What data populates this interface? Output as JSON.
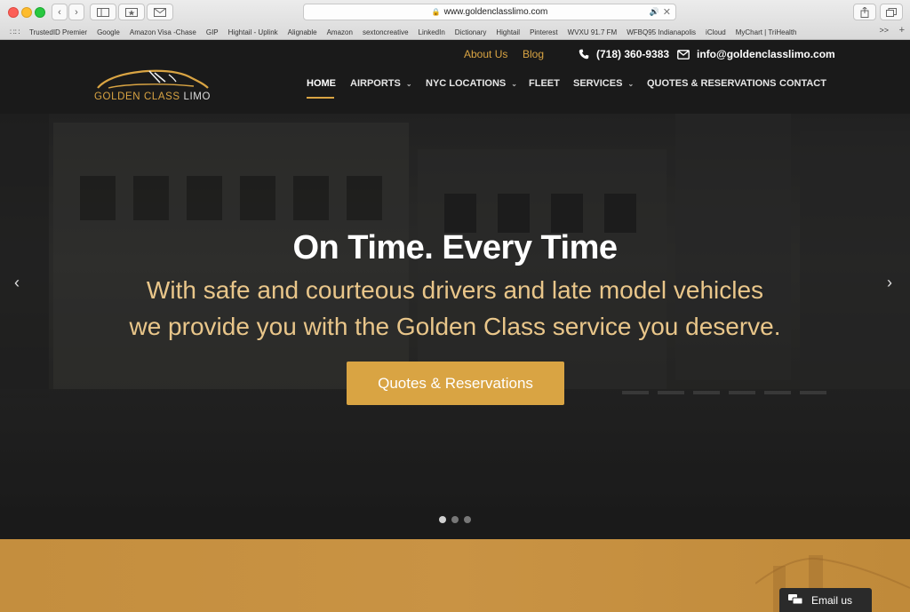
{
  "browser": {
    "url": "www.goldenclasslimo.com",
    "bookmarks": [
      "TrustedID Premier",
      "Google",
      "Amazon Visa -Chase",
      "GIP",
      "Hightail - Uplink",
      "Alignable",
      "Amazon",
      "sextoncreative",
      "LinkedIn",
      "Dictionary",
      "Hightail",
      "Pinterest",
      "WVXU 91.7 FM",
      "WFBQ95 Indianapolis",
      "iCloud",
      "MyChart | TriHealth"
    ],
    "more_label": ">>",
    "new_tab_label": "+"
  },
  "topbar": {
    "about_label": "About Us",
    "blog_label": "Blog",
    "phone": "(718) 360-9383",
    "email": "info@goldenclasslimo.com"
  },
  "logo": {
    "gold_text": "GOLDEN CLASS",
    "white_text": "LIMO"
  },
  "nav": {
    "home": "HOME",
    "airports": "AIRPORTS",
    "nyc_locations": "NYC LOCATIONS",
    "fleet": "FLEET",
    "services": "SERVICES",
    "quotes": "QUOTES & RESERVATIONS",
    "contact": "CONTACT"
  },
  "hero": {
    "title": "On Time. Every Time",
    "subtitle_line1": "With safe and courteous drivers and late model vehicles",
    "subtitle_line2": "we provide you with the Golden Class service you deserve.",
    "cta_label": "Quotes & Reservations",
    "prev_label": "‹",
    "next_label": "›"
  },
  "widget": {
    "email_label": "Email us"
  },
  "colors": {
    "gold": "#d9a443",
    "header_bg": "#1a1a1a",
    "band_gold": "#c99344"
  }
}
